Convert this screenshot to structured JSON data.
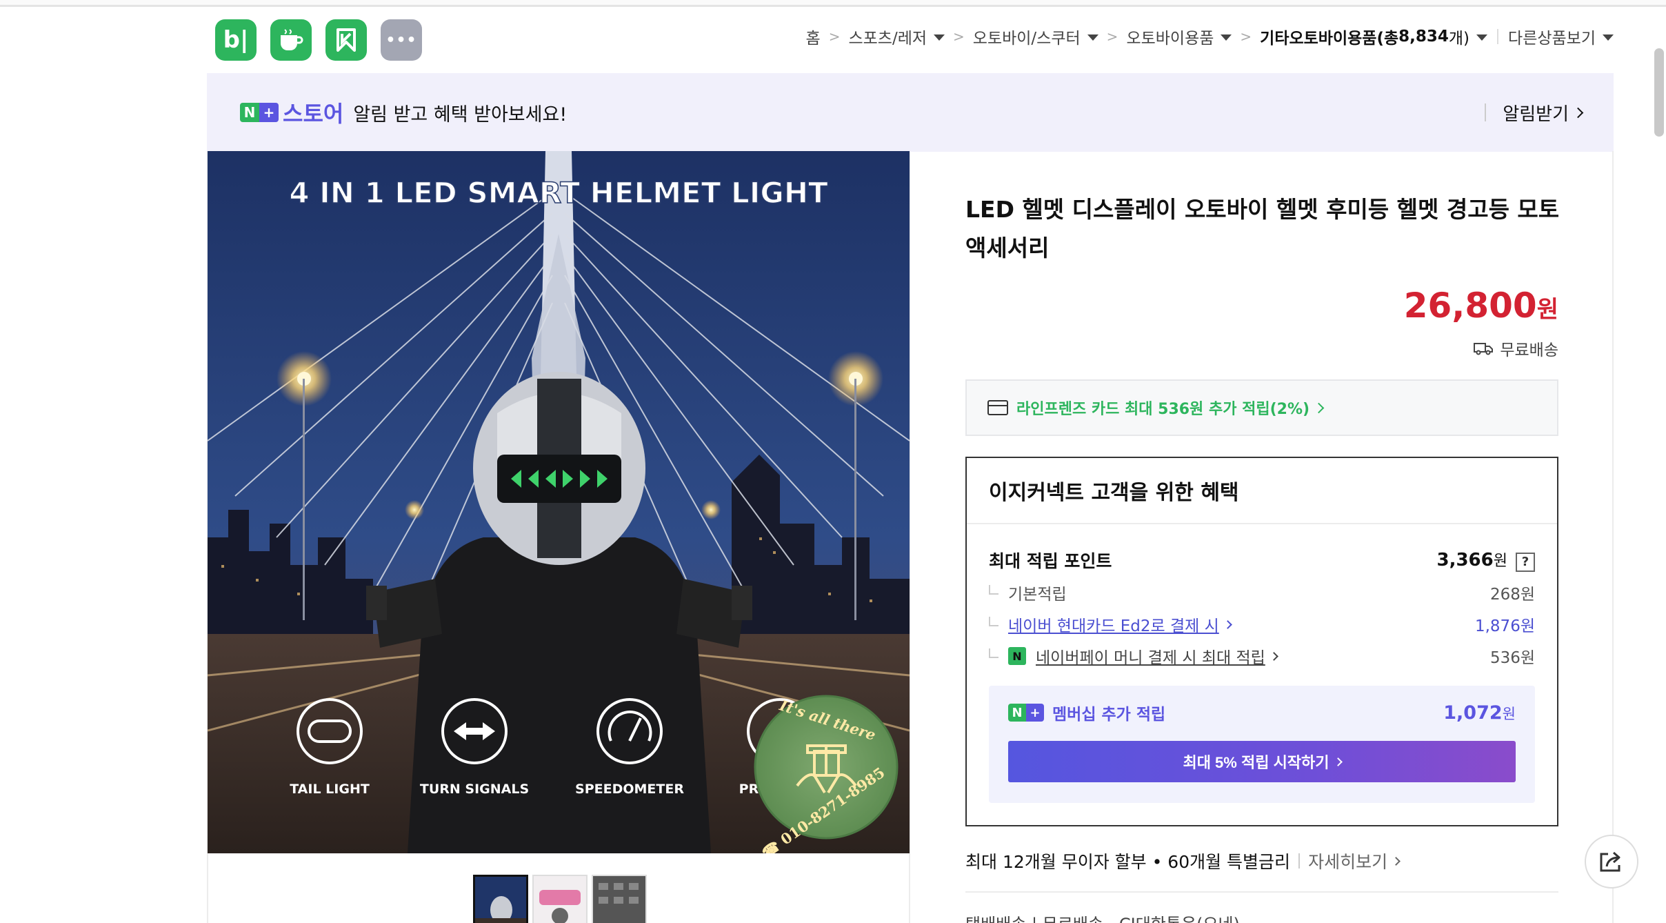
{
  "app_icons": [
    {
      "name": "blog",
      "label": "b|"
    },
    {
      "name": "cafe",
      "label": ""
    },
    {
      "name": "kin",
      "label": ""
    },
    {
      "name": "more",
      "label": "•••"
    }
  ],
  "breadcrumb": {
    "home": "홈",
    "sep": ">",
    "items": [
      "스포츠/레저",
      "오토바이/스쿠터",
      "오토바이용품"
    ],
    "current": "기타오토바이용품(총 ",
    "current_count": "8,834",
    "current_suffix": "개)",
    "other": "다른상품보기"
  },
  "alert_banner": {
    "n": "N",
    "plus": "+",
    "store": "스토어",
    "text": "알림 받고 혜택 받아보세요!",
    "action": "알림받기"
  },
  "product_image": {
    "headline": "4 IN 1 LED SMART HELMET LIGHT",
    "features": [
      "TAIL LIGHT",
      "TURN SIGNALS",
      "SPEEDOMETER",
      "PROC"
    ],
    "badge_top": "It's all there",
    "badge_phone": "☎ 010-8271-8985"
  },
  "product": {
    "title": "LED 헬멧 디스플레이 오토바이 헬멧 후미등 헬멧 경고등 모토 액세서리",
    "price": "26,800",
    "price_unit": "원",
    "shipping": "무료배송"
  },
  "card_promo": "라인프렌즈 카드 최대 536원 추가 적립(2%)",
  "benefits": {
    "title": "이지커넥트 고객을 위한 혜택",
    "max_points_label": "최대 적립 포인트",
    "max_points_value": "3,366",
    "won": "원",
    "help": "?",
    "basic_label": "기본적립",
    "basic_value": "268원",
    "card_label": "네이버 현대카드 Ed2로 결제 시",
    "card_value": "1,876원",
    "npay_icon": "N",
    "npay_label": "네이버페이 머니 결제 시 최대 적립",
    "npay_value": "536원",
    "member_label": "멤버십 추가 적립",
    "member_value": "1,072",
    "member_button": "최대 5% 적립 시작하기"
  },
  "installment": {
    "text": "최대 12개월 무이자 할부 • 60개월 특별금리",
    "more": "자세히보기"
  },
  "shipping_info": "택배배송 | 무료배송 · CJ대한통운(오네)",
  "colors": {
    "naver_green": "#2db55d",
    "naver_purple": "#5b55e0",
    "price_red": "#d32232",
    "banner_bg": "#f1f0fb"
  }
}
